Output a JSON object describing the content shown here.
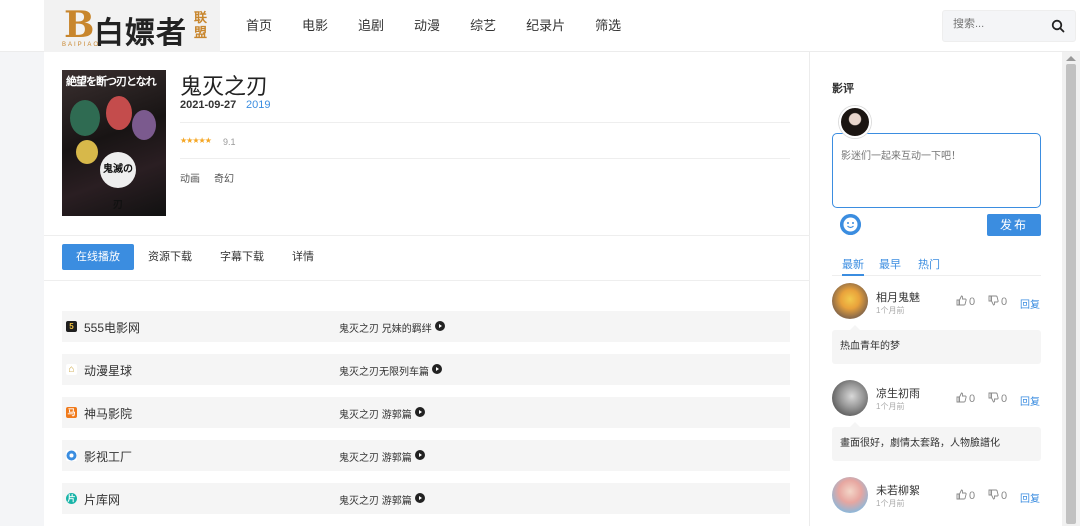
{
  "header": {
    "logo": {
      "letter": "B",
      "text": "白嫖者",
      "union": "联盟",
      "sub": "BAIPIAO"
    },
    "nav": [
      "首页",
      "电影",
      "追剧",
      "动漫",
      "综艺",
      "纪录片",
      "筛选"
    ],
    "search_placeholder": "搜索..."
  },
  "movie": {
    "poster_text": "絶望を断つ刃となれ",
    "poster_logo": "鬼滅の刃",
    "title": "鬼灭之刃",
    "date": "2021-09-27",
    "year": "2019",
    "stars": "★★★★★",
    "rating": "9.1",
    "tags": [
      "动画",
      "奇幻"
    ]
  },
  "tabs": [
    "在线播放",
    "资源下载",
    "字幕下载",
    "详情"
  ],
  "sources": [
    {
      "name": "555电影网",
      "episode": "鬼灭之刃 兄妹的羁绊",
      "icon": "555-icon",
      "color": "#1f1f1f"
    },
    {
      "name": "动漫星球",
      "episode": "鬼灭之刃无限列车篇",
      "icon": "house-icon",
      "color": "#c9a23c"
    },
    {
      "name": "神马影院",
      "episode": "鬼灭之刃 游郭篇",
      "icon": "horse-icon",
      "color": "#f07a1b"
    },
    {
      "name": "影视工厂",
      "episode": "鬼灭之刃 游郭篇",
      "icon": "factory-icon",
      "color": "#3b8de0"
    },
    {
      "name": "片库网",
      "episode": "鬼灭之刃 游郭篇",
      "icon": "pianku-icon",
      "color": "#18b4a8"
    }
  ],
  "side": {
    "title": "影评",
    "comment_placeholder": "影迷们一起来互动一下吧！",
    "publish": "发布",
    "sort_tabs": [
      "最新",
      "最早",
      "热门"
    ],
    "comments": [
      {
        "name": "相月鬼魅",
        "time": "1个月前",
        "likes": "0",
        "dislikes": "0",
        "reply": "回复",
        "text": "热血青年的梦"
      },
      {
        "name": "凉生初雨",
        "time": "1个月前",
        "likes": "0",
        "dislikes": "0",
        "reply": "回复",
        "text": "畫面很好，劇情太套路，人物臉譜化"
      },
      {
        "name": "未若柳絮",
        "time": "1个月前",
        "likes": "0",
        "dislikes": "0",
        "reply": "回复",
        "text": ""
      }
    ]
  }
}
